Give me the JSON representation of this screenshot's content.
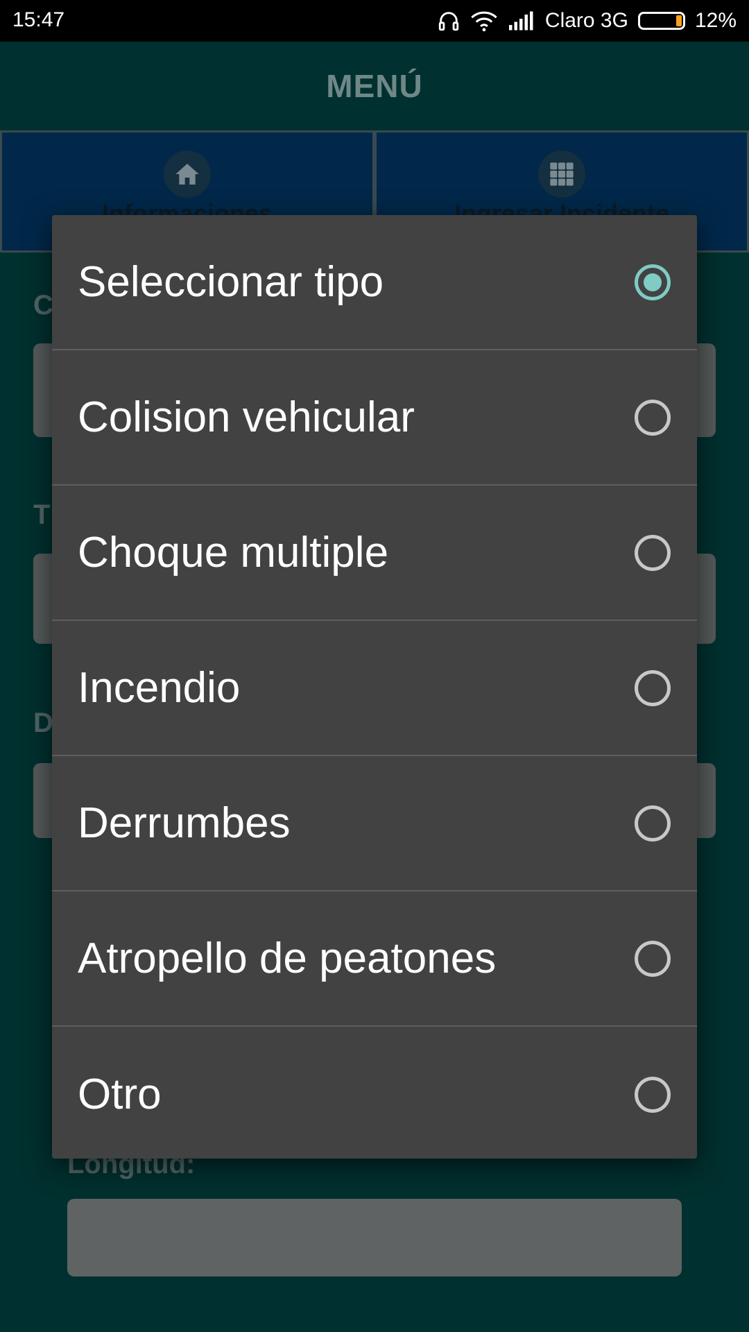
{
  "status_bar": {
    "time": "15:47",
    "carrier": "Claro 3G",
    "battery": "12%",
    "icons": [
      "headphones-icon",
      "wifi-icon",
      "signal-icon",
      "battery-icon"
    ]
  },
  "app": {
    "title": "MENÚ",
    "nav_tabs": [
      {
        "label": "Informaciones",
        "icon": "home-icon"
      },
      {
        "label": "Ingresar Incidente",
        "icon": "grid-icon"
      }
    ],
    "field_labels": [
      "C",
      "T",
      "D",
      "Longitud:"
    ]
  },
  "dialog": {
    "selected_index": 0,
    "options": [
      {
        "label": "Seleccionar tipo",
        "checked": true
      },
      {
        "label": "Colision vehicular",
        "checked": false
      },
      {
        "label": "Choque multiple",
        "checked": false
      },
      {
        "label": "Incendio",
        "checked": false
      },
      {
        "label": "Derrumbes",
        "checked": false
      },
      {
        "label": "Atropello de peatones",
        "checked": false
      },
      {
        "label": "Otro",
        "checked": false
      }
    ],
    "accent_color": "#80cbc4"
  }
}
